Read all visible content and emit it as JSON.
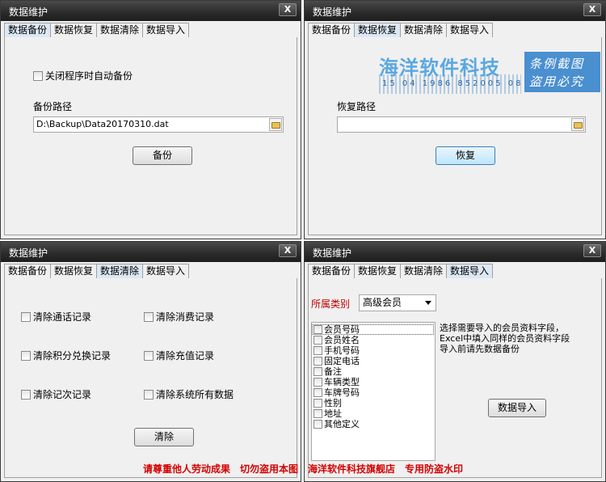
{
  "window_title": "数据维护",
  "close_label": "X",
  "tabs": [
    "数据备份",
    "数据恢复",
    "数据清除",
    "数据导入"
  ],
  "backup": {
    "auto_backup_label": "关闭程序时自动备份",
    "path_label": "备份路径",
    "path_value": "D:\\Backup\\Data20170310.dat",
    "button": "备份"
  },
  "restore": {
    "path_label": "恢复路径",
    "path_value": "",
    "button": "恢复"
  },
  "clear": {
    "options": [
      "清除通话记录",
      "清除消费记录",
      "清除积分兑换记录",
      "清除充值记录",
      "清除记次记录",
      "清除系统所有数据"
    ],
    "button": "清除"
  },
  "import": {
    "category_label": "所属类别",
    "category_value": "高级会员",
    "fields": [
      "会员号码",
      "会员姓名",
      "手机号码",
      "固定电话",
      "备注",
      "车辆类型",
      "车牌号码",
      "性别",
      "地址",
      "其他定义"
    ],
    "instructions": [
      "选择需要导入的会员资料字段，",
      "Excel中填入同样的会员资料字段",
      "导入前请先数据备份"
    ],
    "button": "数据导入"
  },
  "watermark": {
    "title": "海洋软件科技",
    "numbers": "15 04 1986 852005 08 10",
    "box_line1": "条例截图",
    "box_line2": "盗用必究"
  },
  "footer_text": "请尊重他人劳动成果　切勿盗用本图　海洋软件科技旗舰店　专用防盗水印",
  "colors": {
    "accent_label": "#c00000",
    "footer": "#d40000",
    "watermark": "#4a8fcf"
  }
}
